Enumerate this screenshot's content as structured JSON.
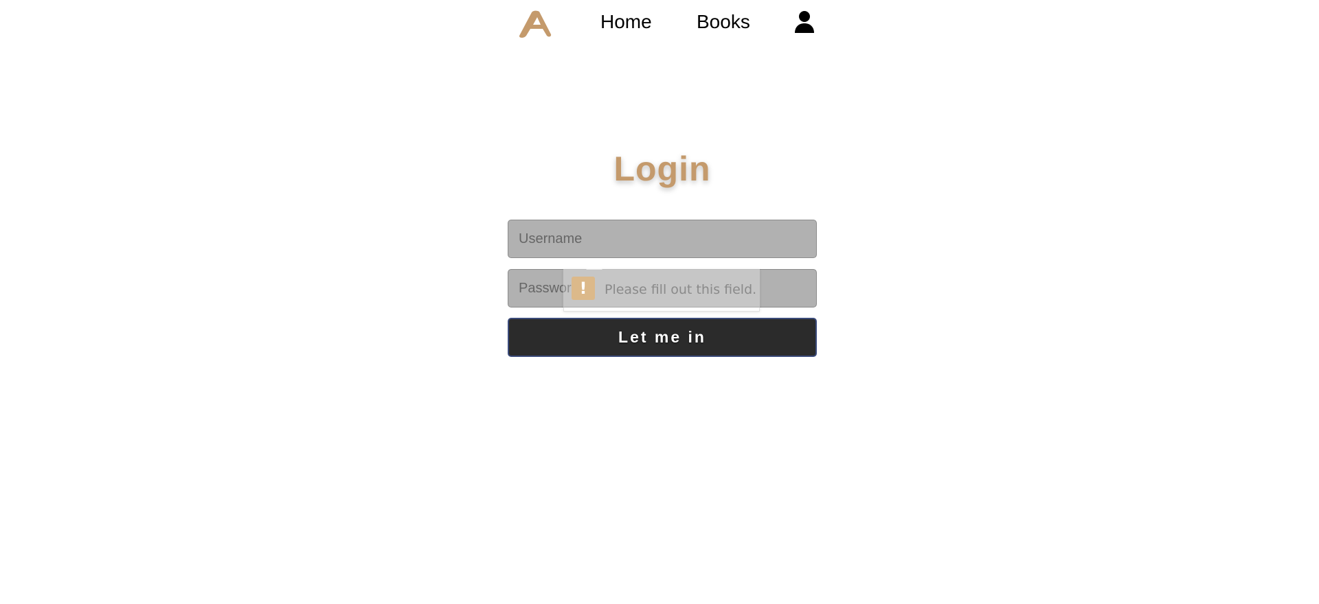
{
  "colors": {
    "brand": "#c49a6c",
    "field_bg": "#b1b1b1",
    "button_bg": "#2b2b2b",
    "button_text": "#ffffff",
    "tooltip_icon_bg": "#dcb98a"
  },
  "nav": {
    "logo_icon": "brand-logo-a-icon",
    "logo_letter": "A",
    "items": [
      {
        "label": "Home"
      },
      {
        "label": "Books"
      }
    ],
    "account_icon": "user-icon"
  },
  "login": {
    "title": "Login",
    "username": {
      "value": "",
      "placeholder": "Username"
    },
    "password": {
      "value": "",
      "placeholder": "Password"
    },
    "submit_label": "Let me in"
  },
  "validation": {
    "icon": "warning-icon",
    "icon_glyph": "!",
    "message": "Please fill out this field."
  }
}
